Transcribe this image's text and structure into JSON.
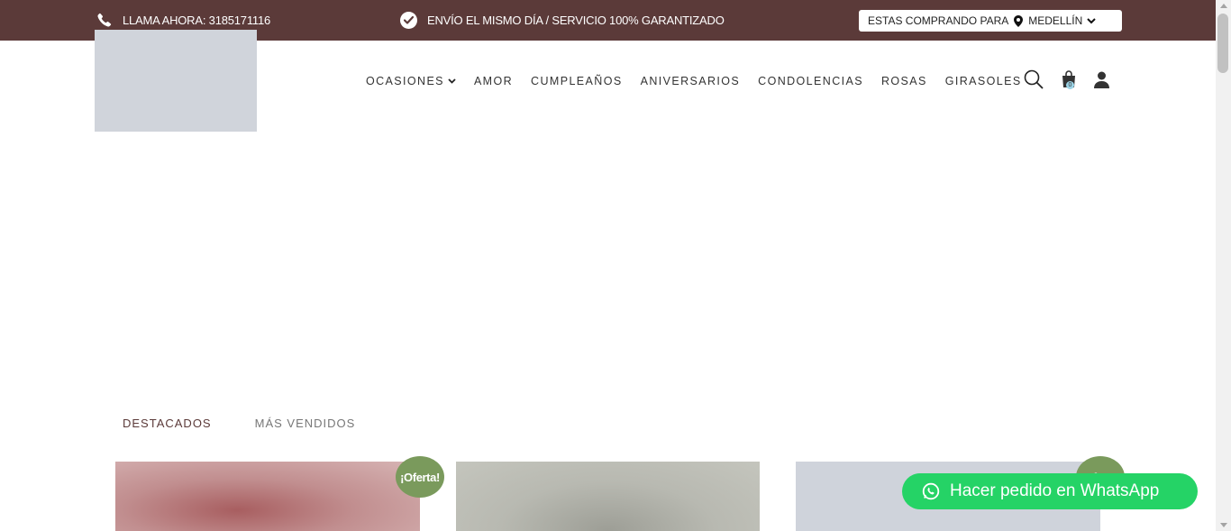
{
  "topbar": {
    "call_label": "LLAMA AHORA: 3185171116",
    "shipping_label": "ENVÍO EL MISMO DÍA / SERVICIO 100% GARANTIZADO",
    "buying_for_label": "ESTAS COMPRANDO PARA",
    "city": "MEDELLÍN",
    "bg_color": "#5b3a39"
  },
  "nav": {
    "items": [
      {
        "label": "OCASIONES",
        "has_dropdown": true
      },
      {
        "label": "AMOR"
      },
      {
        "label": "CUMPLEAÑOS"
      },
      {
        "label": "ANIVERSARIOS"
      },
      {
        "label": "CONDOLENCIAS"
      },
      {
        "label": "ROSAS"
      },
      {
        "label": "GIRASOLES"
      }
    ],
    "icons": [
      "search-icon",
      "shopping-bag-icon",
      "user-icon"
    ],
    "cart_count": "0"
  },
  "tabs": {
    "items": [
      {
        "label": "DESTACADOS",
        "active": true
      },
      {
        "label": "MÁS VENDIDOS",
        "active": false
      }
    ]
  },
  "products": {
    "badge_label": "¡Oferta!",
    "badge_color": "#7a9a5c"
  },
  "whatsapp": {
    "label": "Hacer pedido en WhatsApp",
    "color": "#25d366"
  }
}
